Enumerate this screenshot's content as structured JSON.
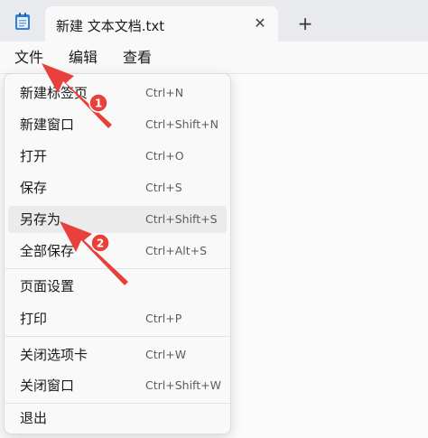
{
  "tab": {
    "title": "新建 文本文档.txt",
    "close_glyph": "✕"
  },
  "new_tab_glyph": "+",
  "menubar": {
    "file": "文件",
    "edit": "编辑",
    "view": "查看"
  },
  "file_menu": {
    "items": [
      {
        "label": "新建标签页",
        "shortcut": "Ctrl+N"
      },
      {
        "label": "新建窗口",
        "shortcut": "Ctrl+Shift+N"
      },
      {
        "label": "打开",
        "shortcut": "Ctrl+O"
      },
      {
        "label": "保存",
        "shortcut": "Ctrl+S"
      },
      {
        "label": "另存为",
        "shortcut": "Ctrl+Shift+S"
      },
      {
        "label": "全部保存",
        "shortcut": "Ctrl+Alt+S"
      },
      {
        "label": "页面设置",
        "shortcut": ""
      },
      {
        "label": "打印",
        "shortcut": "Ctrl+P"
      },
      {
        "label": "关闭选项卡",
        "shortcut": "Ctrl+W"
      },
      {
        "label": "关闭窗口",
        "shortcut": "Ctrl+Shift+W"
      },
      {
        "label": "退出",
        "shortcut": ""
      }
    ],
    "highlighted": "另存为"
  },
  "annotations": {
    "badge_1": "1",
    "badge_2": "2",
    "color": "#e8403b"
  },
  "icons": {
    "app": "notepad-icon",
    "close": "close-icon",
    "add": "plus-icon"
  }
}
